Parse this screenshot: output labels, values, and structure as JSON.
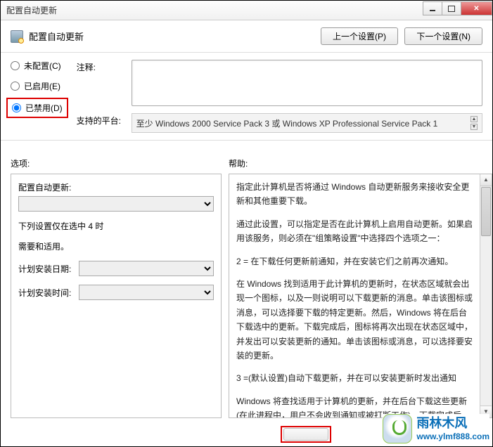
{
  "window": {
    "title": "配置自动更新"
  },
  "header": {
    "heading": "配置自动更新",
    "prev_button": "上一个设置(P)",
    "next_button": "下一个设置(N)"
  },
  "radios": {
    "not_configured": "未配置(C)",
    "enabled": "已启用(E)",
    "disabled": "已禁用(D)"
  },
  "meta": {
    "comment_label": "注释:",
    "comment_value": "",
    "platform_label": "支持的平台:",
    "platform_value": "至少 Windows 2000 Service Pack 3 或 Windows XP Professional Service Pack 1"
  },
  "sections": {
    "options_label": "选项:",
    "help_label": "帮助:"
  },
  "options": {
    "config_label": "配置自动更新:",
    "config_value": "",
    "note1": "下列设置仅在选中 4 时",
    "note2": "需要和适用。",
    "date_label": "计划安装日期:",
    "date_value": "",
    "time_label": "计划安装时间:",
    "time_value": ""
  },
  "help": {
    "p1": "指定此计算机是否将通过 Windows 自动更新服务来接收安全更新和其他重要下载。",
    "p2": "通过此设置，可以指定是否在此计算机上启用自动更新。如果启用该服务，则必须在\"组策略设置\"中选择四个选项之一：",
    "p3": "2 = 在下载任何更新前通知，并在安装它们之前再次通知。",
    "p4": "在 Windows 找到适用于此计算机的更新时，在状态区域就会出现一个图标，以及一则说明可以下载更新的消息。单击该图标或消息，可以选择要下载的特定更新。然后，Windows 将在后台下载选中的更新。下载完成后，图标将再次出现在状态区域中，并发出可以安装更新的通知。单击该图标或消息，可以选择要安装的更新。",
    "p5": "3 =(默认设置)自动下载更新，并在可以安装更新时发出通知",
    "p6": "Windows 将查找适用于计算机的更新，并在后台下载这些更新(在此进程中，用户不会收到通知或被打断工作)。下载完成后，图标将出现在状态区域中，并发"
  },
  "watermark": {
    "name": "雨林木风",
    "url": "www.ylmf888.com"
  }
}
